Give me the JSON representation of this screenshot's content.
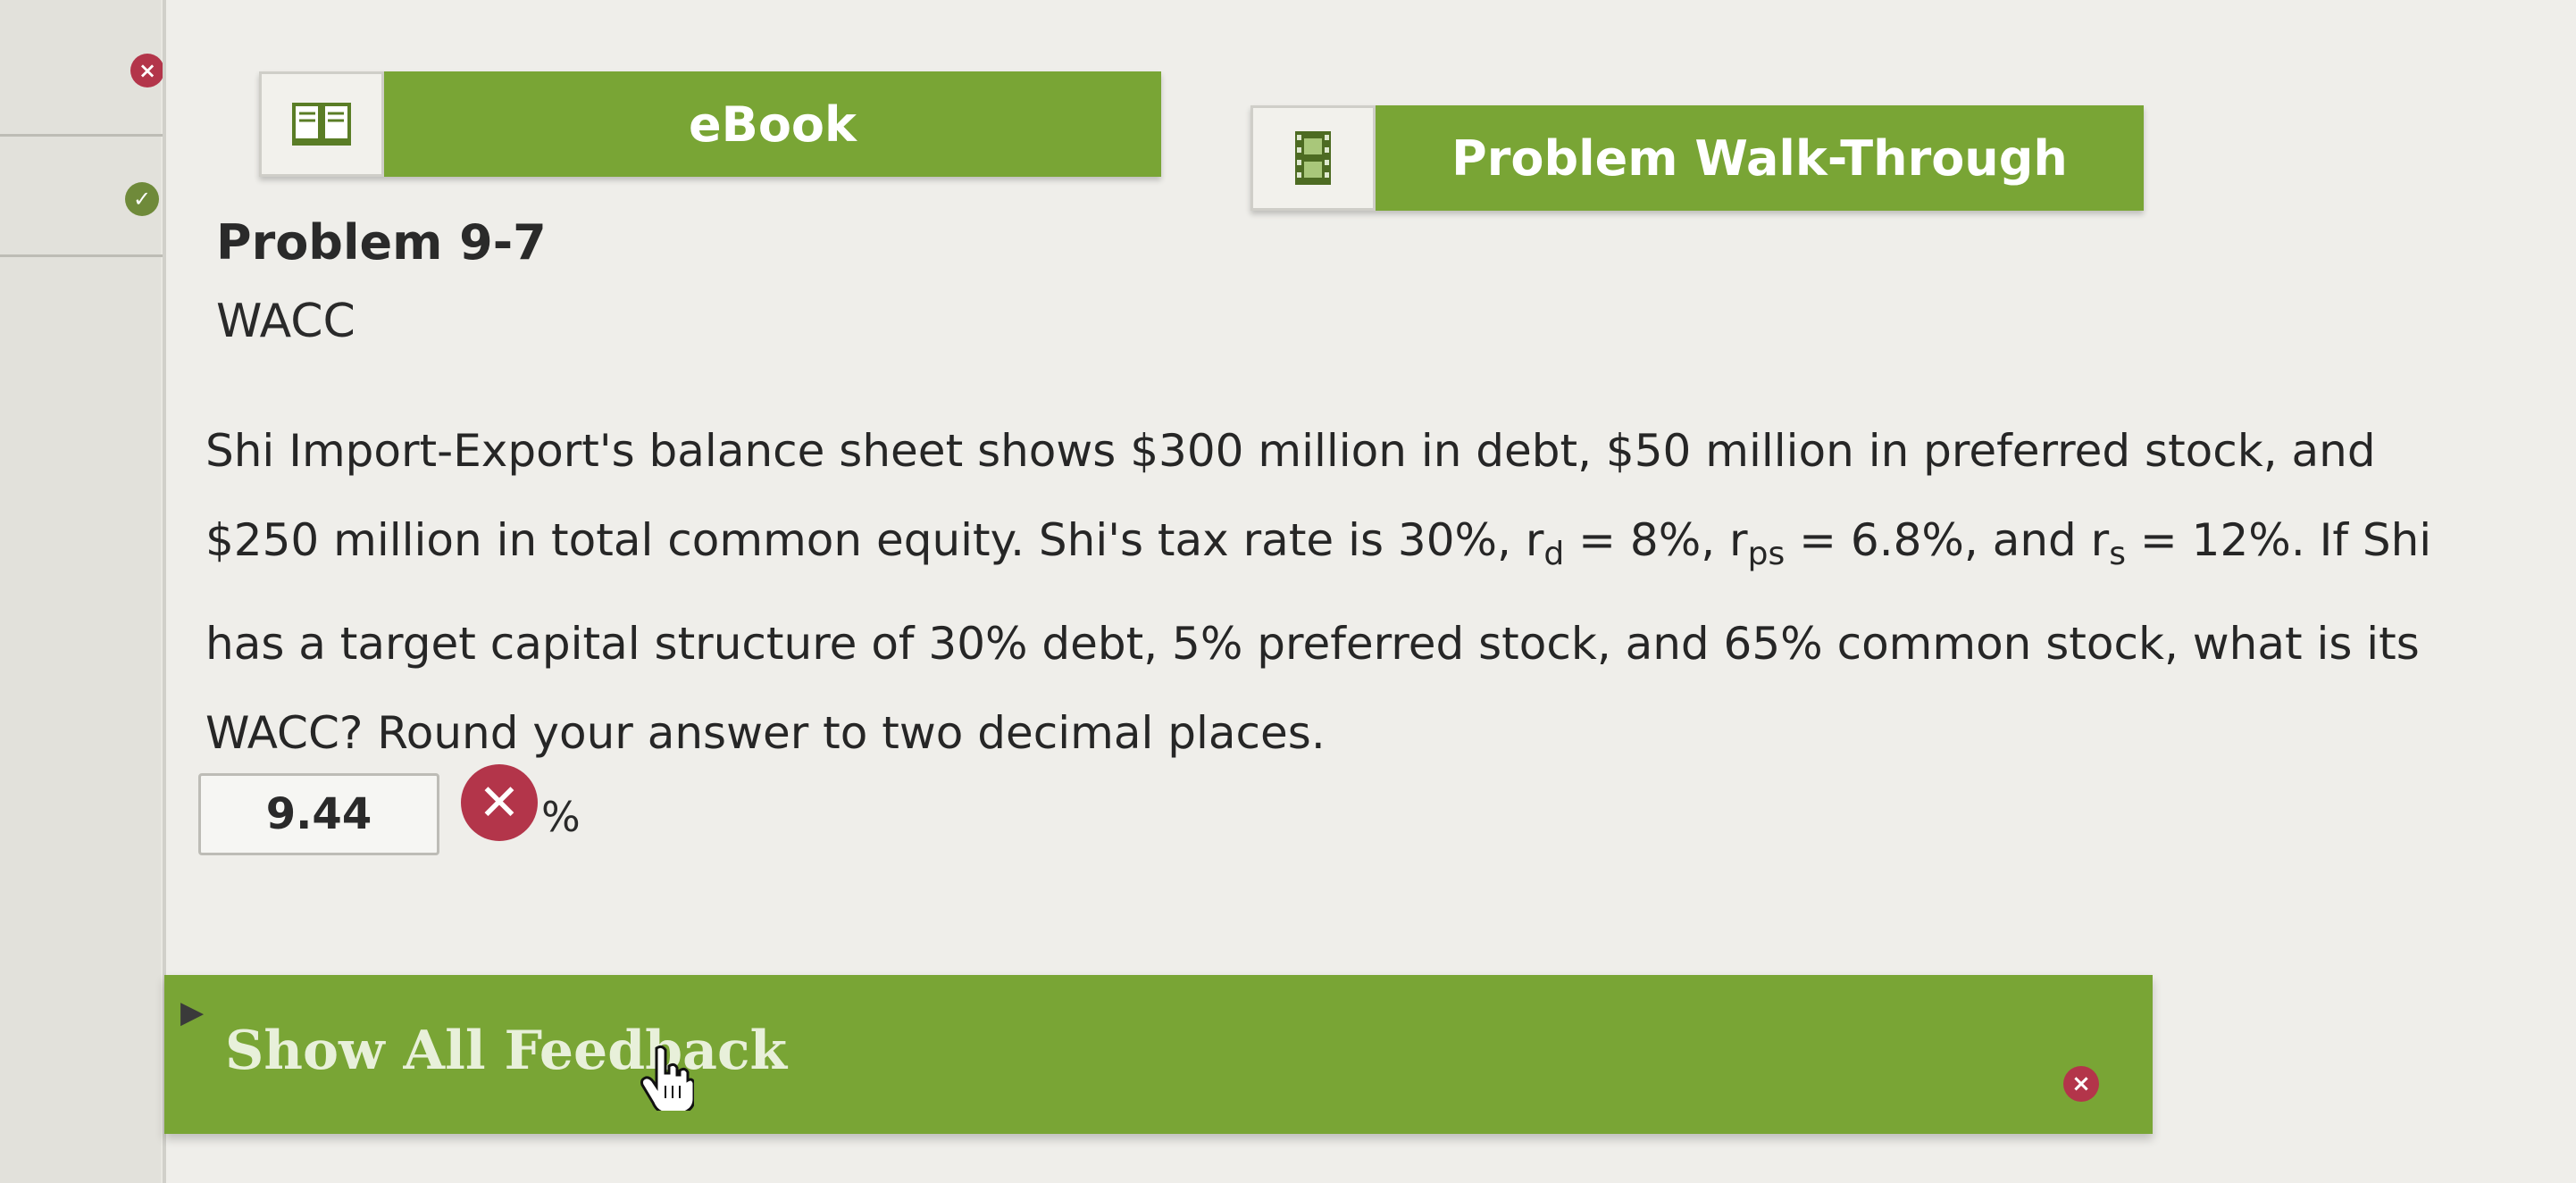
{
  "nav": {
    "status_wrong_icon": "close-circle-icon",
    "status_pending_icon": "check-circle-icon"
  },
  "tabs": {
    "ebook_label": "eBook",
    "ebook_icon": "book-icon",
    "walkthrough_label": "Problem Walk-Through",
    "walkthrough_icon": "film-icon"
  },
  "problem": {
    "title": "Problem 9-7",
    "subtitle": "WACC",
    "text_part1": "Shi Import-Export's balance sheet shows $300 million in debt, $50 million in preferred stock, and $250 million in total common equity. Shi's tax rate is 30%, r",
    "sub_d": "d",
    "text_part2": " = 8%, r",
    "sub_ps": "ps",
    "text_part3": " = 6.8%, and r",
    "sub_s": "s",
    "text_part4": " = 12%. If Shi has a target capital structure of 30% debt, 5% preferred stock, and 65% common stock, what is its WACC? Round your answer to two decimal places."
  },
  "answer": {
    "value": "9.44",
    "unit": "%",
    "status": "incorrect"
  },
  "feedback": {
    "label": "Show All Feedback"
  },
  "colors": {
    "accent_green": "#79a535",
    "error_red": "#b3354a",
    "background": "#efeeea"
  }
}
